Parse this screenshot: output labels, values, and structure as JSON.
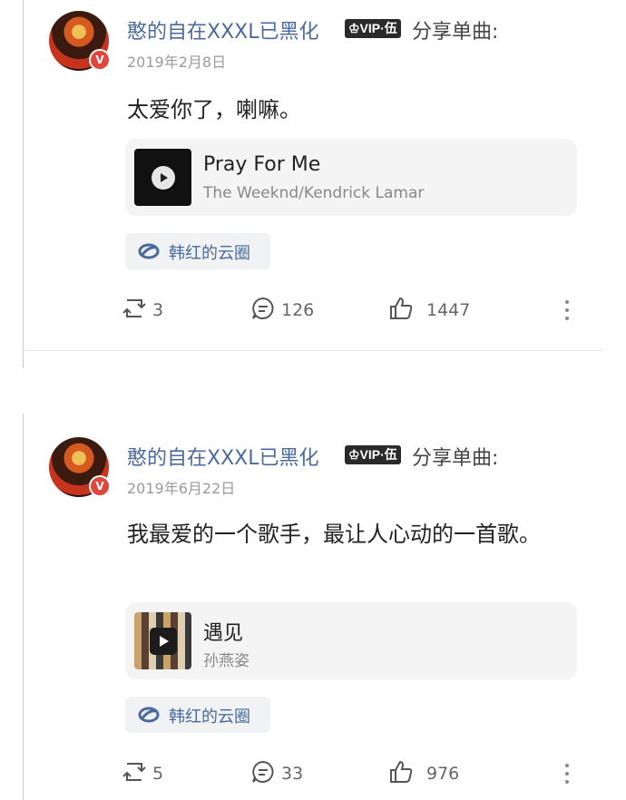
{
  "posts": [
    {
      "username": "憨的自在XXXL已黑化",
      "vip_badge": "♔VIP·伍",
      "share_label": "分享单曲:",
      "date": "2019年2月8日",
      "text": "太爱你了，喇嘛。",
      "song": {
        "title": "Pray For Me",
        "artist": "The Weeknd/Kendrick Lamar"
      },
      "circle_tag": "韩红的云圈",
      "reposts": "3",
      "comments": "126",
      "likes": "1447"
    },
    {
      "username": "憨的自在XXXL已黑化",
      "vip_badge": "♔VIP·伍",
      "share_label": "分享单曲:",
      "date": "2019年6月22日",
      "text": "我最爱的一个歌手，最让人心动的一首歌。",
      "song": {
        "title": "遇见",
        "artist": "孙燕姿"
      },
      "circle_tag": "韩红的云圈",
      "reposts": "5",
      "comments": "33",
      "likes": "976"
    }
  ],
  "verified_badge": "V",
  "colors": {
    "username": "#4a6a9e",
    "meta": "#9a9a9a",
    "card_bg": "#f4f4f4",
    "tag_bg": "#f1f2f4"
  },
  "icons": [
    "repost-icon",
    "comment-icon",
    "like-icon",
    "more-icon",
    "circle-icon",
    "play-icon"
  ]
}
